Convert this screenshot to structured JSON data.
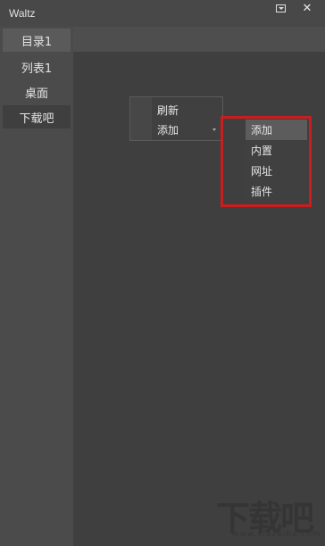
{
  "window": {
    "title": "Waltz"
  },
  "titlebar": {
    "menu_icon": "dropdown-box-icon",
    "close_glyph": "✕"
  },
  "sidebar": {
    "items": [
      {
        "label": "目录1",
        "state": "active"
      },
      {
        "label": "列表1",
        "state": "normal"
      },
      {
        "label": "桌面",
        "state": "normal"
      },
      {
        "label": "下载吧",
        "state": "hover"
      }
    ]
  },
  "context_menu": {
    "items": [
      {
        "label": "刷新"
      },
      {
        "label": "添加",
        "has_submenu": true
      }
    ]
  },
  "submenu": {
    "items": [
      {
        "label": "添加",
        "highlighted": true
      },
      {
        "label": "内置"
      },
      {
        "label": "网址"
      },
      {
        "label": "插件"
      }
    ]
  },
  "annotation": {
    "color": "#c81e1e"
  },
  "watermark": {
    "main": "下载吧",
    "sub": "www.xiazaiba.com"
  },
  "colors": {
    "background": "#474747",
    "content": "#3f3f3f",
    "menu": "#404040",
    "menu_highlight": "#5c5c5c"
  }
}
